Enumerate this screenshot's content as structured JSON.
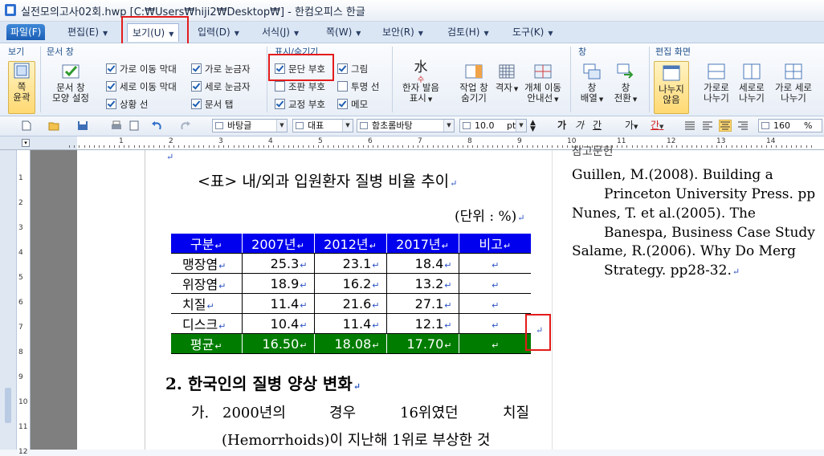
{
  "window": {
    "title": "실전모의고사02회.hwp [C:₩Users₩hiji2₩Desktop₩] - 한컴오피스 한글"
  },
  "menubar": {
    "items": [
      {
        "label": "파일(F)"
      },
      {
        "label": "편집(E)"
      },
      {
        "label": "보기(U)"
      },
      {
        "label": "입력(D)"
      },
      {
        "label": "서식(J)"
      },
      {
        "label": "쪽(W)"
      },
      {
        "label": "보안(R)"
      },
      {
        "label": "검토(H)"
      },
      {
        "label": "도구(K)"
      }
    ]
  },
  "ribbon": {
    "groups": {
      "view": "보기",
      "doc_window": "문서 창",
      "show_hide": "표시/숨기기",
      "window": "창",
      "edit_screen": "편집 화면"
    },
    "page_outline": "쪽\n윤곽",
    "doc_window_shape": [
      "문서 창",
      "모양 설정"
    ],
    "checks": [
      {
        "label": "가로 이동 막대",
        "checked": true
      },
      {
        "label": "세로 이동 막대",
        "checked": true
      },
      {
        "label": "상황 선",
        "checked": true
      },
      {
        "label": "가로 눈금자",
        "checked": true
      },
      {
        "label": "세로 눈금자",
        "checked": true
      },
      {
        "label": "문서 탭",
        "checked": true
      },
      {
        "label": "문단 부호",
        "checked": true
      },
      {
        "label": "조판 부호",
        "checked": false
      },
      {
        "label": "교정 부호",
        "checked": true
      },
      {
        "label": "그림",
        "checked": true
      },
      {
        "label": "투명 선",
        "checked": false
      },
      {
        "label": "메모",
        "checked": true
      }
    ],
    "hanja": [
      "한자 발음",
      "표시"
    ],
    "hanja_icon": "水",
    "hanja_icon_sub": "수",
    "task_window": [
      "작업 창",
      "숨기기"
    ],
    "grid": [
      "격자"
    ],
    "object_move": [
      "개체 이동",
      "안내선"
    ],
    "window_arrange": [
      "창",
      "배열"
    ],
    "window_switch": [
      "창",
      "전환"
    ],
    "split_none": [
      "나누지",
      "않음"
    ],
    "split_h": [
      "가로로",
      "나누기"
    ],
    "split_v": [
      "세로로",
      "나누기"
    ],
    "split_hv": [
      "가로 세로",
      "나누기"
    ]
  },
  "toolbar": {
    "style": "바탕글",
    "lang": "대표",
    "font": "함초롬바탕",
    "size": "10.0",
    "size_unit": "pt",
    "bold": "가",
    "italic": "가",
    "underline": "간",
    "strike": "가",
    "color": "간",
    "zoom": "160",
    "zoom_unit": "%"
  },
  "ruler": {
    "h_numbers": [
      "1",
      "2",
      "3",
      "4",
      "5",
      "6",
      "7",
      "8",
      "9",
      "10",
      "11",
      "12",
      "13",
      "14"
    ],
    "v_numbers": [
      "1",
      "2",
      "3",
      "4",
      "5",
      "6",
      "7",
      "8",
      "9",
      "10",
      "11",
      "12"
    ]
  },
  "document": {
    "table_title": "<표> 내/외과 입원환자 질병 비율 추이",
    "unit": "(단위 : %)",
    "table": {
      "headers": [
        "구분",
        "2007년",
        "2012년",
        "2017년",
        "비고"
      ],
      "rows": [
        [
          "맹장염",
          "25.3",
          "23.1",
          "18.4",
          ""
        ],
        [
          "위장염",
          "18.9",
          "16.2",
          "13.2",
          ""
        ],
        [
          "치질",
          "11.4",
          "21.6",
          "27.1",
          ""
        ],
        [
          "디스크",
          "10.4",
          "11.4",
          "12.1",
          ""
        ]
      ],
      "avg": [
        "평균",
        "16.50",
        "18.08",
        "17.70",
        ""
      ]
    },
    "heading": "2. 한국인의 질병 양상 변화",
    "para": {
      "line1": [
        "가.",
        "2000년의",
        "경우",
        "16위였던",
        "치질"
      ],
      "line2": "(Hemorrhoids)이 지난해 1위로 부상한 것"
    },
    "refs": {
      "r0": "참고문헌",
      "r1a": "Guillen,  M.(2008).  Building  a",
      "r1b": "Princeton University Press. pp",
      "r2a": "Nunes,  T.  et  al.(2005).  The",
      "r2b": "Banespa, Business Case Study",
      "r3a": "Salame,  R.(2006).  Why  Do  Merg",
      "r3b": "Strategy. pp28-32."
    }
  }
}
